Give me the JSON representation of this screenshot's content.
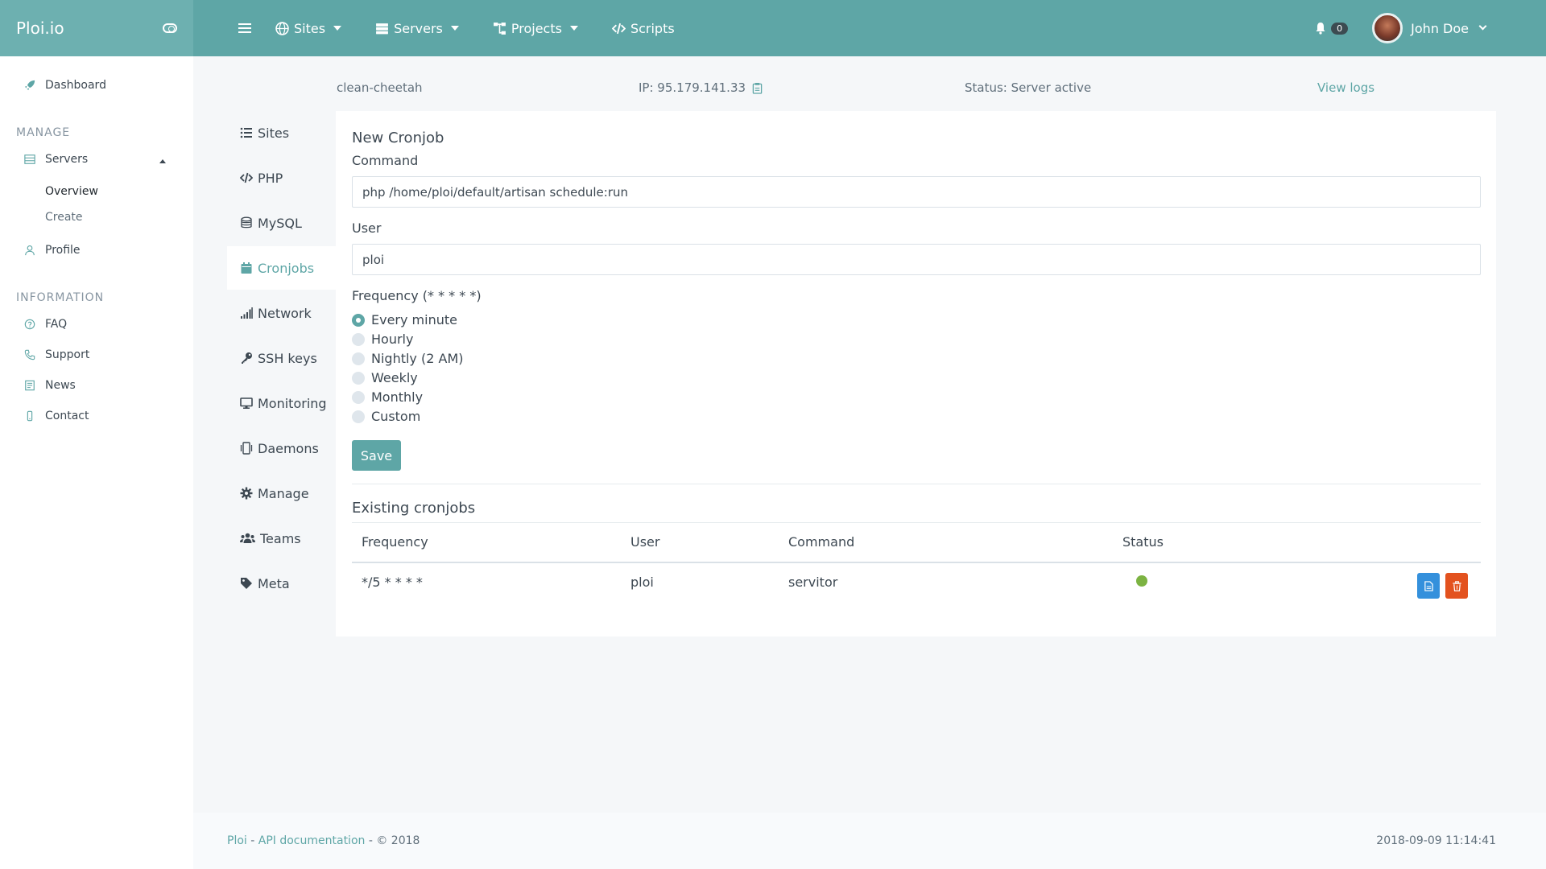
{
  "brand": {
    "name": "Ploi.io"
  },
  "topnav": {
    "items": [
      {
        "label": "Sites",
        "icon": "globe-icon"
      },
      {
        "label": "Servers",
        "icon": "server-icon"
      },
      {
        "label": "Projects",
        "icon": "sitemap-icon"
      },
      {
        "label": "Scripts",
        "icon": "code-icon"
      }
    ],
    "notifications_count": "0",
    "user_name": "John Doe"
  },
  "sidebar": {
    "dashboard": "Dashboard",
    "manage_heading": "MANAGE",
    "servers": "Servers",
    "overview": "Overview",
    "create": "Create",
    "profile": "Profile",
    "information_heading": "INFORMATION",
    "faq": "FAQ",
    "support": "Support",
    "news": "News",
    "contact": "Contact"
  },
  "server": {
    "name": "clean-cheetah",
    "ip": "IP: 95.179.141.33",
    "status": "Status: Server active",
    "view_logs": "View logs"
  },
  "server_menu": [
    "Sites",
    "PHP",
    "MySQL",
    "Cronjobs",
    "Network",
    "SSH keys",
    "Monitoring",
    "Daemons",
    "Manage",
    "Teams",
    "Meta"
  ],
  "form": {
    "title": "New Cronjob",
    "command_label": "Command",
    "command_value": "php /home/ploi/default/artisan schedule:run",
    "user_label": "User",
    "user_value": "ploi",
    "frequency_label": "Frequency (* * * * *)",
    "frequency_options": [
      "Every minute",
      "Hourly",
      "Nightly (2 AM)",
      "Weekly",
      "Monthly",
      "Custom"
    ],
    "selected_frequency": "Every minute",
    "save_label": "Save"
  },
  "existing": {
    "title": "Existing cronjobs",
    "columns": [
      "Frequency",
      "User",
      "Command",
      "Status"
    ],
    "rows": [
      {
        "frequency": "*/5 * * * *",
        "user": "ploi",
        "command": "servitor",
        "status": "active"
      }
    ]
  },
  "footer": {
    "ploi_link": "Ploi",
    "sep1": " - ",
    "api_link": "API documentation",
    "copyright": " - © 2018",
    "timestamp": "2018-09-09 11:14:41"
  },
  "colors": {
    "accent": "#5ea6a6",
    "status_active": "#7cb342",
    "edit_button": "#3490dc",
    "delete_button": "#e3521f"
  }
}
